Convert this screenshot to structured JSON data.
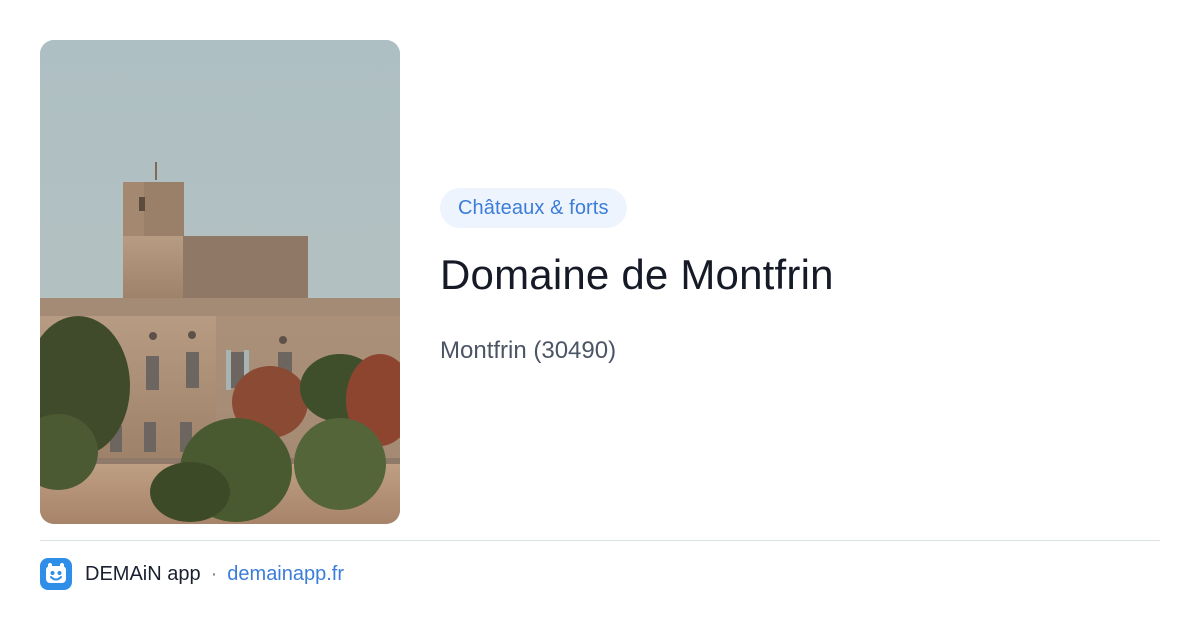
{
  "card": {
    "category_tag": "Châteaux & forts",
    "title": "Domaine de Montfrin",
    "location": "Montfrin (30490)"
  },
  "footer": {
    "app_name": "DEMAiN app",
    "separator": "·",
    "url": "demainapp.fr"
  },
  "colors": {
    "accent": "#3b7dd8",
    "tag_background": "#eef4fd",
    "title_text": "#151a26",
    "secondary_text": "#4b5566",
    "app_icon": "#2f8fe8"
  },
  "icons": {
    "app_logo": "demain-app-logo-icon"
  }
}
